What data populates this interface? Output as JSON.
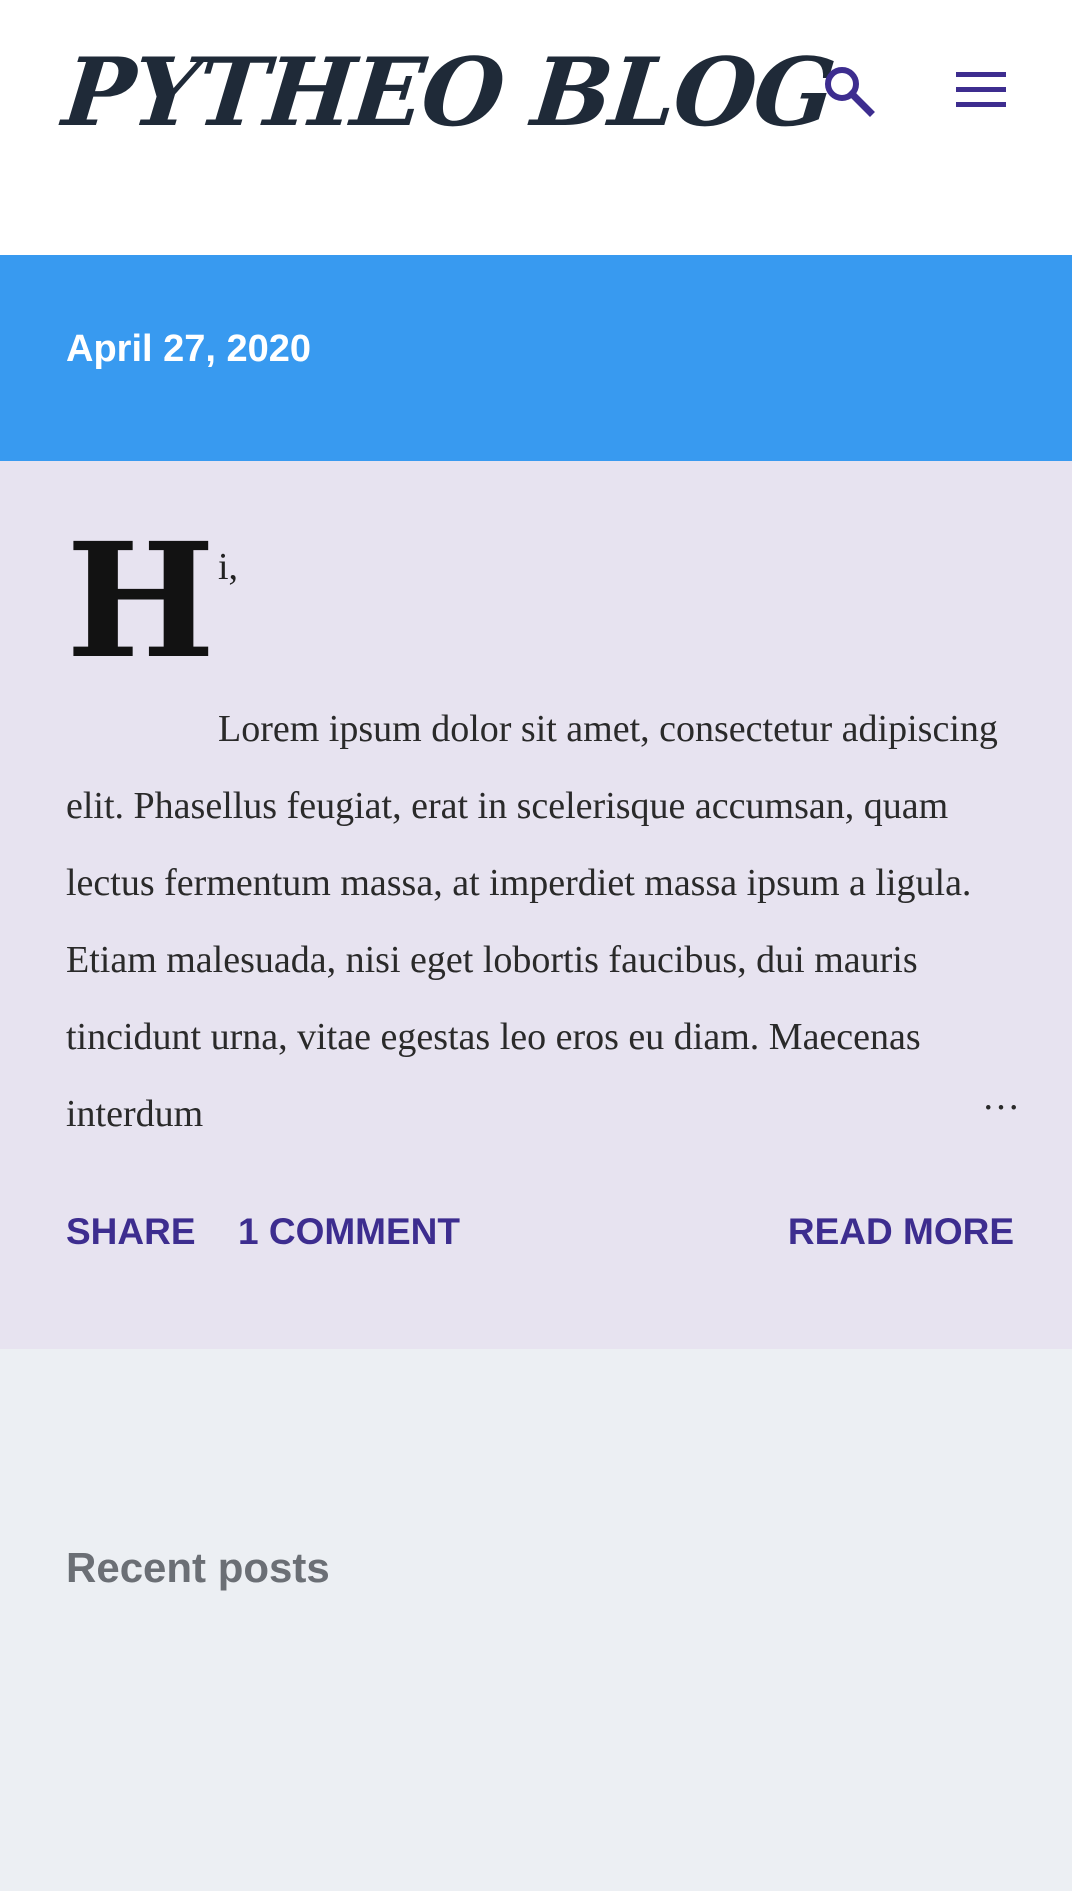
{
  "header": {
    "site_title": "PYTHEO BLOG",
    "icons": {
      "search": "search-icon",
      "menu": "menu-icon"
    }
  },
  "post": {
    "date": "April 27, 2020",
    "drop_cap": "H",
    "first_line": "i,",
    "body": "Lorem ipsum dolor sit amet, consectetur adipiscing elit. Phasellus feugiat, erat in scelerisque accumsan, quam lectus fermentum massa, at imperdiet massa ipsum a ligula. Etiam malesuada, nisi eget lobortis faucibus, dui mauris tincidunt urna, vitae egestas leo eros eu diam. Maecenas interdum",
    "ellipsis": "…",
    "actions": {
      "share": "SHARE",
      "comments": "1 COMMENT",
      "read_more": "READ MORE"
    }
  },
  "sidebar": {
    "recent_title": "Recent posts"
  },
  "colors": {
    "date_band": "#389af0",
    "post_background": "#e7e3f0",
    "page_background": "#eceff3",
    "accent": "#3d2d8f",
    "title_text": "#1f2a38"
  }
}
